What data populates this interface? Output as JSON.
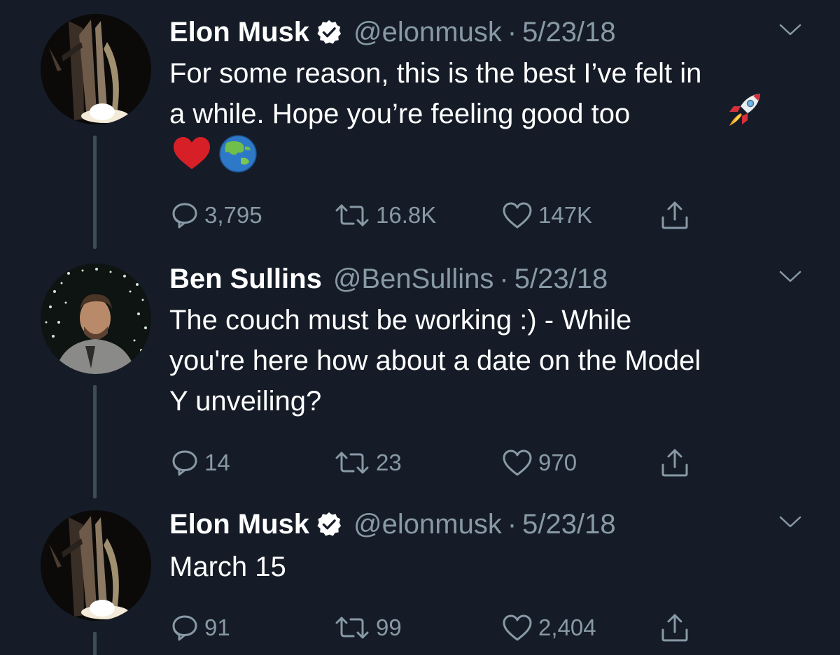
{
  "tweets": [
    {
      "author": "Elon Musk",
      "handle": "@elonmusk",
      "separator": "·",
      "date": "5/23/18",
      "verified": true,
      "text_lines": [
        "For some reason, this is the best I’ve felt in",
        "a while. Hope you’re feeling good too"
      ],
      "emojis": [
        "rocket-emoji",
        "red-heart-emoji",
        "globe-asia-australia-emoji"
      ],
      "replies": "3,795",
      "retweets": "16.8K",
      "likes": "147K"
    },
    {
      "author": "Ben Sullins",
      "handle": "@BenSullins",
      "separator": "·",
      "date": "5/23/18",
      "verified": false,
      "text_lines": [
        "The couch must be working :) - While",
        "you're here how about a date on the Model",
        "Y unveiling?"
      ],
      "replies": "14",
      "retweets": "23",
      "likes": "970"
    },
    {
      "author": "Elon Musk",
      "handle": "@elonmusk",
      "separator": "·",
      "date": "5/23/18",
      "verified": true,
      "text_lines": [
        "March 15"
      ],
      "replies": "91",
      "retweets": "99",
      "likes": "2,404"
    }
  ],
  "icons": {
    "reply": "reply-icon",
    "retweet": "retweet-icon",
    "like": "heart-icon",
    "share": "share-icon",
    "caret": "chevron-down-icon",
    "verified": "verified-badge-icon"
  },
  "colors": {
    "background": "#151c27",
    "text": "#ffffff",
    "muted": "#8899a6",
    "thread_line": "#3d4b5b"
  }
}
